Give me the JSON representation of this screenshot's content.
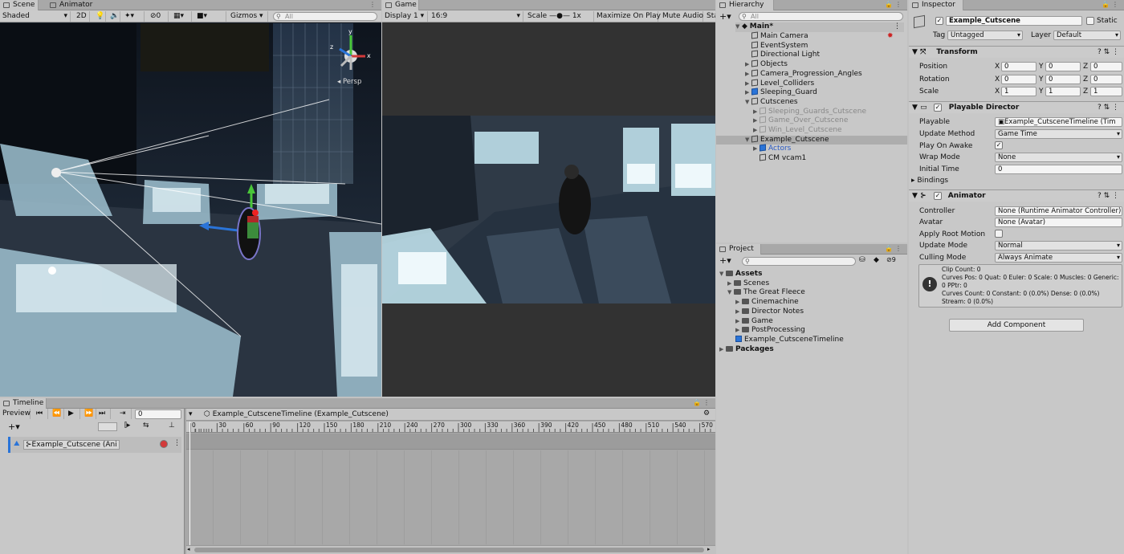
{
  "scene": {
    "tab_scene": "Scene",
    "tab_animator": "Animator",
    "shading": "Shaded",
    "mode_2d": "2D",
    "fx_count": "0",
    "gizmos": "Gizmos",
    "search_placeholder": "All",
    "persp": "Persp"
  },
  "game": {
    "tab": "Game",
    "display": "Display 1",
    "aspect": "16:9",
    "scale_label": "Scale",
    "scale_value": "1x",
    "maximize": "Maximize On Play",
    "mute": "Mute Audio",
    "stats": "Sta"
  },
  "hierarchy": {
    "tab": "Hierarchy",
    "search_placeholder": "All",
    "scene_name": "Main*",
    "items": [
      {
        "label": "Main Camera"
      },
      {
        "label": "EventSystem"
      },
      {
        "label": "Directional Light"
      },
      {
        "label": "Objects"
      },
      {
        "label": "Camera_Progression_Angles"
      },
      {
        "label": "Level_Colliders"
      },
      {
        "label": "Sleeping_Guard"
      },
      {
        "label": "Cutscenes"
      },
      {
        "label": "Sleeping_Guards_Cutscene"
      },
      {
        "label": "Game_Over_Cutscene"
      },
      {
        "label": "Win_Level_Cutscene"
      },
      {
        "label": "Example_Cutscene"
      },
      {
        "label": "Actors"
      },
      {
        "label": "CM vcam1"
      }
    ]
  },
  "project": {
    "tab": "Project",
    "asset_count": "9",
    "items": [
      {
        "label": "Assets"
      },
      {
        "label": "Scenes"
      },
      {
        "label": "The Great Fleece"
      },
      {
        "label": "Cinemachine"
      },
      {
        "label": "Director Notes"
      },
      {
        "label": "Game"
      },
      {
        "label": "PostProcessing"
      },
      {
        "label": "Example_CutsceneTimeline"
      },
      {
        "label": "Packages"
      }
    ]
  },
  "inspector": {
    "tab": "Inspector",
    "object_name": "Example_Cutscene",
    "static_label": "Static",
    "tag_label": "Tag",
    "tag_value": "Untagged",
    "layer_label": "Layer",
    "layer_value": "Default",
    "transform": {
      "title": "Transform",
      "position": "Position",
      "rotation": "Rotation",
      "scale": "Scale",
      "x": "X",
      "y": "Y",
      "z": "Z",
      "pos": [
        "0",
        "0",
        "0"
      ],
      "rot": [
        "0",
        "0",
        "0"
      ],
      "scl": [
        "1",
        "1",
        "1"
      ]
    },
    "director": {
      "title": "Playable Director",
      "playable_label": "Playable",
      "playable_value": "Example_CutsceneTimeline (Tim",
      "update_label": "Update Method",
      "update_value": "Game Time",
      "awake_label": "Play On Awake",
      "wrap_label": "Wrap Mode",
      "wrap_value": "None",
      "init_label": "Initial Time",
      "init_value": "0",
      "bindings": "Bindings"
    },
    "animator": {
      "title": "Animator",
      "controller_label": "Controller",
      "controller_value": "None (Runtime Animator Controller)",
      "avatar_label": "Avatar",
      "avatar_value": "None (Avatar)",
      "root_label": "Apply Root Motion",
      "update_label": "Update Mode",
      "update_value": "Normal",
      "culling_label": "Culling Mode",
      "culling_value": "Always Animate",
      "info": "Clip Count: 0\nCurves Pos: 0 Quat: 0 Euler: 0 Scale: 0 Muscles: 0 Generic: 0 PPtr: 0\nCurves Count: 0 Constant: 0 (0.0%) Dense: 0 (0.0%) Stream: 0 (0.0%)"
    },
    "add_component": "Add Component"
  },
  "timeline": {
    "tab": "Timeline",
    "preview": "Preview",
    "frame": "0",
    "asset_label": "Example_CutsceneTimeline (Example_Cutscene)",
    "track_label": "Example_Cutscene (Ani",
    "ruler": [
      "0",
      "30",
      "60",
      "90",
      "120",
      "150",
      "180",
      "210",
      "240",
      "270",
      "300",
      "330",
      "360",
      "390",
      "420",
      "450",
      "480",
      "510",
      "540",
      "570"
    ]
  },
  "colors": {
    "accent_blue": "#2a74d8",
    "selection": "#3a72c4",
    "record_red": "#d33a3a"
  }
}
